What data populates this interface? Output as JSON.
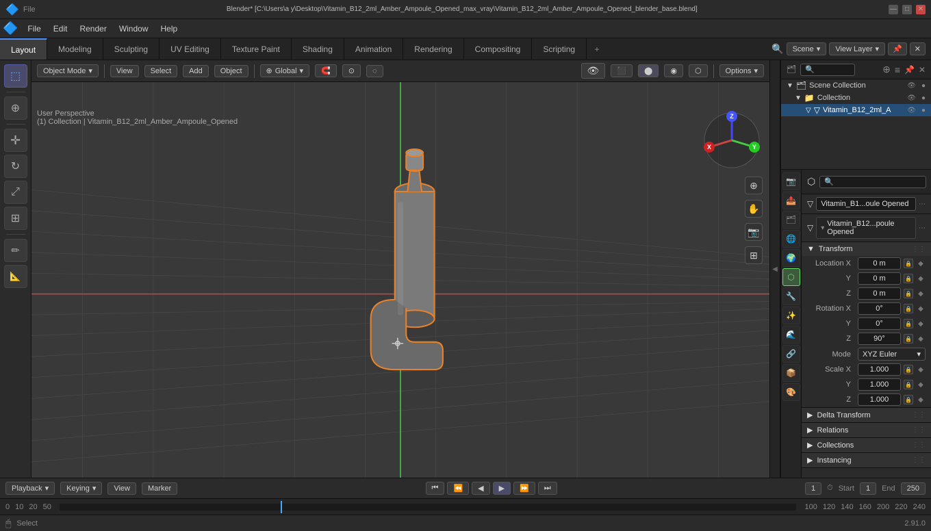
{
  "titlebar": {
    "title": "Blender* [C:\\Users\\a y\\Desktop\\Vitamin_B12_2ml_Amber_Ampoule_Opened_max_vray\\Vitamin_B12_2ml_Amber_Ampoule_Opened_blender_base.blend]",
    "logo": "🔷",
    "min_btn": "—",
    "max_btn": "□",
    "close_btn": "✕"
  },
  "menubar": {
    "items": [
      "File",
      "Edit",
      "Render",
      "Window",
      "Help"
    ]
  },
  "workspacebar": {
    "tabs": [
      "Layout",
      "Modeling",
      "Sculpting",
      "UV Editing",
      "Texture Paint",
      "Shading",
      "Animation",
      "Rendering",
      "Compositing",
      "Scripting"
    ],
    "active": "Layout",
    "add_btn": "+",
    "scene_label": "Scene",
    "viewlayer_label": "View Layer"
  },
  "viewport": {
    "mode_btn": "Object Mode",
    "view_btn": "View",
    "select_btn": "Select",
    "add_btn": "Add",
    "object_btn": "Object",
    "transform_global": "Global",
    "info_line1": "User Perspective",
    "info_line2": "(1) Collection | Vitamin_B12_2ml_Amber_Ampoule_Opened",
    "options_btn": "Options"
  },
  "tools": {
    "items": [
      {
        "name": "select-box",
        "icon": "⬚",
        "active": true
      },
      {
        "name": "cursor",
        "icon": "⊕",
        "active": false
      },
      {
        "name": "move",
        "icon": "✛",
        "active": false
      },
      {
        "name": "rotate",
        "icon": "↻",
        "active": false
      },
      {
        "name": "scale",
        "icon": "⤢",
        "active": false
      },
      {
        "name": "transform",
        "icon": "⊞",
        "active": false
      },
      {
        "name": "annotate",
        "icon": "✏",
        "active": false
      },
      {
        "name": "measure",
        "icon": "📐",
        "active": false
      }
    ]
  },
  "outliner": {
    "search_placeholder": "🔍",
    "items": [
      {
        "label": "Scene Collection",
        "icon": "🗂",
        "level": 0,
        "expanded": true
      },
      {
        "label": "Collection",
        "icon": "📁",
        "level": 1,
        "expanded": true,
        "visible": true
      },
      {
        "label": "Vitamin_B12_2ml_A",
        "icon": "▽",
        "level": 2,
        "selected": true,
        "visible": true
      }
    ]
  },
  "properties": {
    "active_tab": "object",
    "tabs": [
      "🔧",
      "📷",
      "⬡",
      "🔵",
      "🌊",
      "✨",
      "🎨",
      "💡",
      "📦",
      "🔗",
      "🎞"
    ],
    "object_name": "Vitamin_B1...oule Opened",
    "data_name": "Vitamin_B12...poule Opened",
    "transform": {
      "label": "Transform",
      "location_x": "0 m",
      "location_y": "0 m",
      "location_z": "0 m",
      "rotation_x": "0°",
      "rotation_y": "0°",
      "rotation_z": "90°",
      "mode": "XYZ Euler",
      "scale_x": "1.000",
      "scale_y": "1.000",
      "scale_z": "1.000"
    },
    "delta_transform": {
      "label": "Delta Transform"
    },
    "relations": {
      "label": "Relations"
    },
    "collections": {
      "label": "Collections"
    },
    "instancing": {
      "label": "Instancing"
    }
  },
  "bottom": {
    "playback_btn": "Playback",
    "keying_btn": "Keying",
    "view_btn": "View",
    "marker_btn": "Marker",
    "frame_current": "1",
    "frame_start_label": "Start",
    "frame_start": "1",
    "frame_end_label": "End",
    "frame_end": "250",
    "transport_icons": [
      "⏮",
      "⏪",
      "◀",
      "▶",
      "▶▶",
      "⏭"
    ],
    "fps_icon": "⏱"
  },
  "statusbar": {
    "select_label": "Select",
    "version": "2.91.0",
    "mouse_icon": "🖱"
  },
  "colors": {
    "accent_blue": "#4d90fe",
    "active_orange": "#e8822a",
    "bg_dark": "#1a1a1a",
    "bg_panel": "#2b2b2b",
    "bg_viewport": "#393939",
    "grid_line": "#444",
    "axis_x": "#c44",
    "axis_y": "#4c4",
    "axis_z": "#44c",
    "selection_blue": "#264f78"
  }
}
